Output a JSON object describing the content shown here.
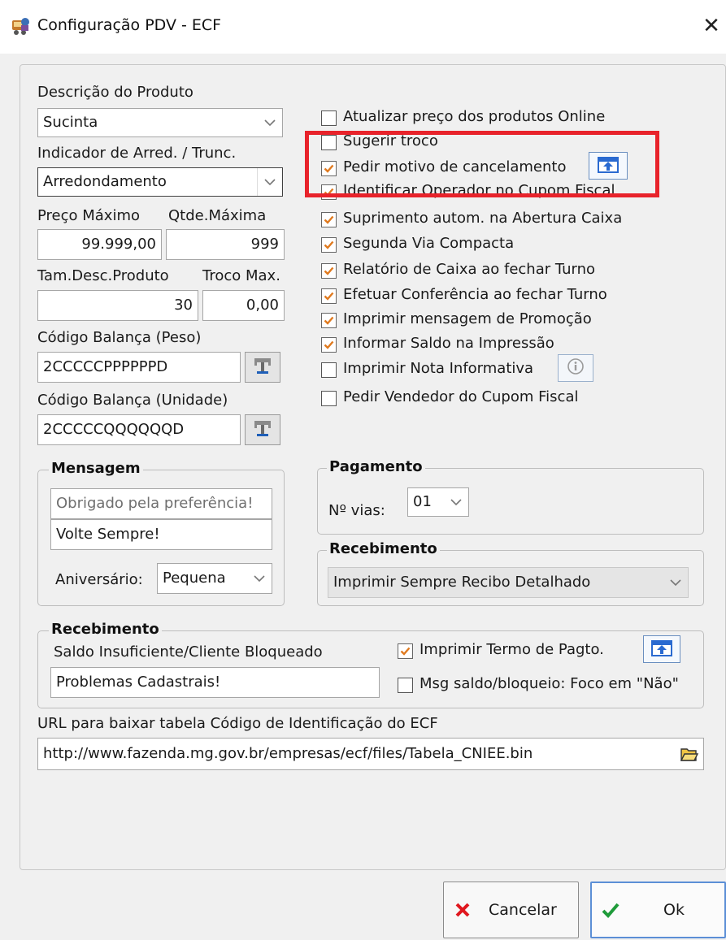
{
  "window": {
    "title": "Configuração PDV - ECF",
    "close_glyph": "✕"
  },
  "left": {
    "descricao_label": "Descrição do Produto",
    "descricao_value": "Sucinta",
    "indicador_label": "Indicador de Arred. / Trunc.",
    "indicador_value": "Arredondamento",
    "preco_label": "Preço Máximo",
    "preco_value": "99.999,00",
    "qtde_label": "Qtde.Máxima",
    "qtde_value": "999",
    "tam_label": "Tam.Desc.Produto",
    "tam_value": "30",
    "troco_label": "Troco Max.",
    "troco_value": "0,00",
    "bal_peso_label": "Código Balança (Peso)",
    "bal_peso_value": "2CCCCCPPPPPPD",
    "bal_un_label": "Código Balança (Unidade)",
    "bal_un_value": "2CCCCCQQQQQQD"
  },
  "checks": [
    {
      "label": "Atualizar preço dos produtos Online",
      "checked": false
    },
    {
      "label": "Sugerir troco",
      "checked": false
    },
    {
      "label": "Pedir motivo de cancelamento",
      "checked": true
    },
    {
      "label": "Identificar Operador no Cupom Fiscal",
      "checked": true
    },
    {
      "label": "Suprimento autom. na Abertura Caixa",
      "checked": true
    },
    {
      "label": "Segunda Via Compacta",
      "checked": true
    },
    {
      "label": "Relatório de Caixa ao fechar Turno",
      "checked": true
    },
    {
      "label": "Efetuar Conferência ao fechar Turno",
      "checked": true
    },
    {
      "label": "Imprimir mensagem de Promoção",
      "checked": true
    },
    {
      "label": "Informar Saldo na Impressão",
      "checked": true
    },
    {
      "label": "Imprimir Nota Informativa",
      "checked": false
    },
    {
      "label": "Pedir Vendedor do Cupom Fiscal",
      "checked": false
    }
  ],
  "mensagem": {
    "title": "Mensagem",
    "placeholder": "Obrigado pela preferência!",
    "value": "Volte Sempre!",
    "aniversario_label": "Aniversário:",
    "aniversario_value": "Pequena"
  },
  "pagamento": {
    "title": "Pagamento",
    "vias_label": "Nº vias:",
    "vias_value": "01"
  },
  "recebimento_right": {
    "title": "Recebimento",
    "value": "Imprimir Sempre Recibo Detalhado"
  },
  "recebimento_bottom": {
    "title": "Recebimento",
    "saldo_label": "Saldo Insuficiente/Cliente Bloqueado",
    "saldo_value": "Problemas Cadastrais!",
    "termo_label": "Imprimir Termo de Pagto.",
    "termo_checked": true,
    "msg_label": "Msg saldo/bloqueio: Foco em \"Não\"",
    "msg_checked": false
  },
  "url": {
    "label": "URL para baixar tabela Código de Identificação do ECF",
    "value": "http://www.fazenda.mg.gov.br/empresas/ecf/files/Tabela_CNIEE.bin"
  },
  "buttons": {
    "cancel": "Cancelar",
    "ok": "Ok"
  },
  "colors": {
    "check": "#e07a1f",
    "highlight": "#e8232b",
    "cancel_x": "#e0171e",
    "ok_check": "#1f9b3a"
  },
  "icons": [
    "app-icon",
    "close-icon",
    "dropdown-arrow-icon",
    "scale-icon",
    "export-icon",
    "info-icon",
    "folder-open-icon",
    "cancel-x-icon",
    "ok-check-icon"
  ]
}
